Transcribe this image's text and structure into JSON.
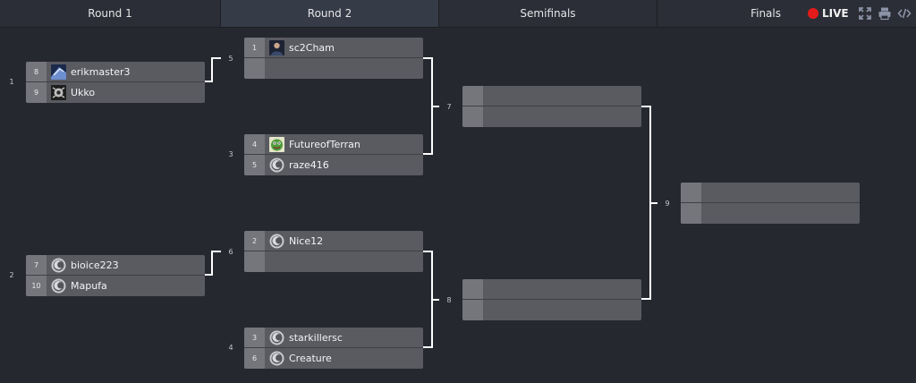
{
  "rounds": [
    "Round 1",
    "Round 2",
    "Semifinals",
    "Finals"
  ],
  "toolbar": {
    "live_label": "LIVE"
  },
  "colors": {
    "live": "#e41b1b",
    "accent_tab": "#353b47"
  },
  "matches": [
    {
      "number": "1",
      "slots": [
        {
          "seed": "8",
          "name": "erikmaster3",
          "icon": "erikmaster3-avatar"
        },
        {
          "seed": "9",
          "name": "Ukko",
          "icon": "ukko-avatar"
        }
      ]
    },
    {
      "number": "2",
      "slots": [
        {
          "seed": "7",
          "name": "bioice223",
          "icon": "default-race-avatar"
        },
        {
          "seed": "10",
          "name": "Mapufa",
          "icon": "default-race-avatar"
        }
      ]
    },
    {
      "number": "5",
      "slots": [
        {
          "seed": "1",
          "name": "sc2Cham",
          "icon": "sc2cham-avatar"
        },
        {
          "seed": "",
          "name": "",
          "icon": ""
        }
      ]
    },
    {
      "number": "3",
      "slots": [
        {
          "seed": "4",
          "name": "FutureofTerran",
          "icon": "futureofterran-avatar"
        },
        {
          "seed": "5",
          "name": "raze416",
          "icon": "default-race-avatar"
        }
      ]
    },
    {
      "number": "6",
      "slots": [
        {
          "seed": "2",
          "name": "Nice12",
          "icon": "default-race-avatar"
        },
        {
          "seed": "",
          "name": "",
          "icon": ""
        }
      ]
    },
    {
      "number": "4",
      "slots": [
        {
          "seed": "3",
          "name": "starkillersc",
          "icon": "default-race-avatar"
        },
        {
          "seed": "6",
          "name": "Creature",
          "icon": "default-race-avatar"
        }
      ]
    },
    {
      "number": "7",
      "slots": [
        {
          "seed": "",
          "name": "",
          "icon": ""
        },
        {
          "seed": "",
          "name": "",
          "icon": ""
        }
      ]
    },
    {
      "number": "8",
      "slots": [
        {
          "seed": "",
          "name": "",
          "icon": ""
        },
        {
          "seed": "",
          "name": "",
          "icon": ""
        }
      ]
    },
    {
      "number": "9",
      "slots": [
        {
          "seed": "",
          "name": "",
          "icon": ""
        },
        {
          "seed": "",
          "name": "",
          "icon": ""
        }
      ]
    }
  ]
}
